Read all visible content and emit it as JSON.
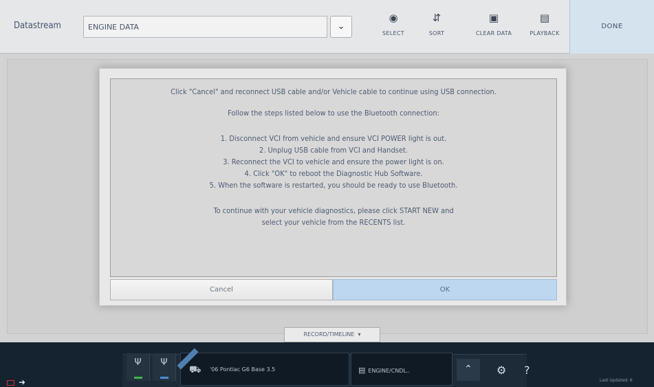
{
  "toolbar": {
    "label": "Datastream",
    "dropdown_value": "ENGINE DATA",
    "buttons": [
      {
        "icon": "select-icon",
        "label": "SELECT"
      },
      {
        "icon": "sort-icon",
        "label": "SORT"
      },
      {
        "icon": "clear-data-icon",
        "label": "CLEAR DATA"
      },
      {
        "icon": "playback-icon",
        "label": "PLAYBACK"
      }
    ],
    "done_label": "DONE"
  },
  "dialog": {
    "line1": "Click \"Cancel\" and reconnect USB cable and/or Vehicle cable to continue using USB connection.",
    "line2": "Follow the steps listed below to use the Bluetooth connection:",
    "steps": [
      "1. Disconnect VCI from vehicle and ensure VCI POWER light is out.",
      "2. Unplug USB cable from VCI and Handset.",
      "3. Reconnect the VCI to vehicle and ensure the power light is on.",
      "4. Click \"OK\" to reboot the Diagnostic Hub Software.",
      "5. When the software is restarted, you should be ready to use Bluetooth."
    ],
    "line3a": "To continue with your vehicle diagnostics, please click START NEW and",
    "line3b": "select your vehicle from the RECENTS list.",
    "cancel_label": "Cancel",
    "ok_label": "OK"
  },
  "record_label": "RECORD/TIMELINE",
  "bottom": {
    "vehicle_text": "'06 Pontiac G6 Base 3.5",
    "engine_text": "ENGINE/CNDL..",
    "status_text": "Last Updated: 6"
  },
  "colors": {
    "ok_button": "#bcd7ef",
    "bottom_bar": "#152230",
    "done_bg": "#d5e3ef"
  }
}
